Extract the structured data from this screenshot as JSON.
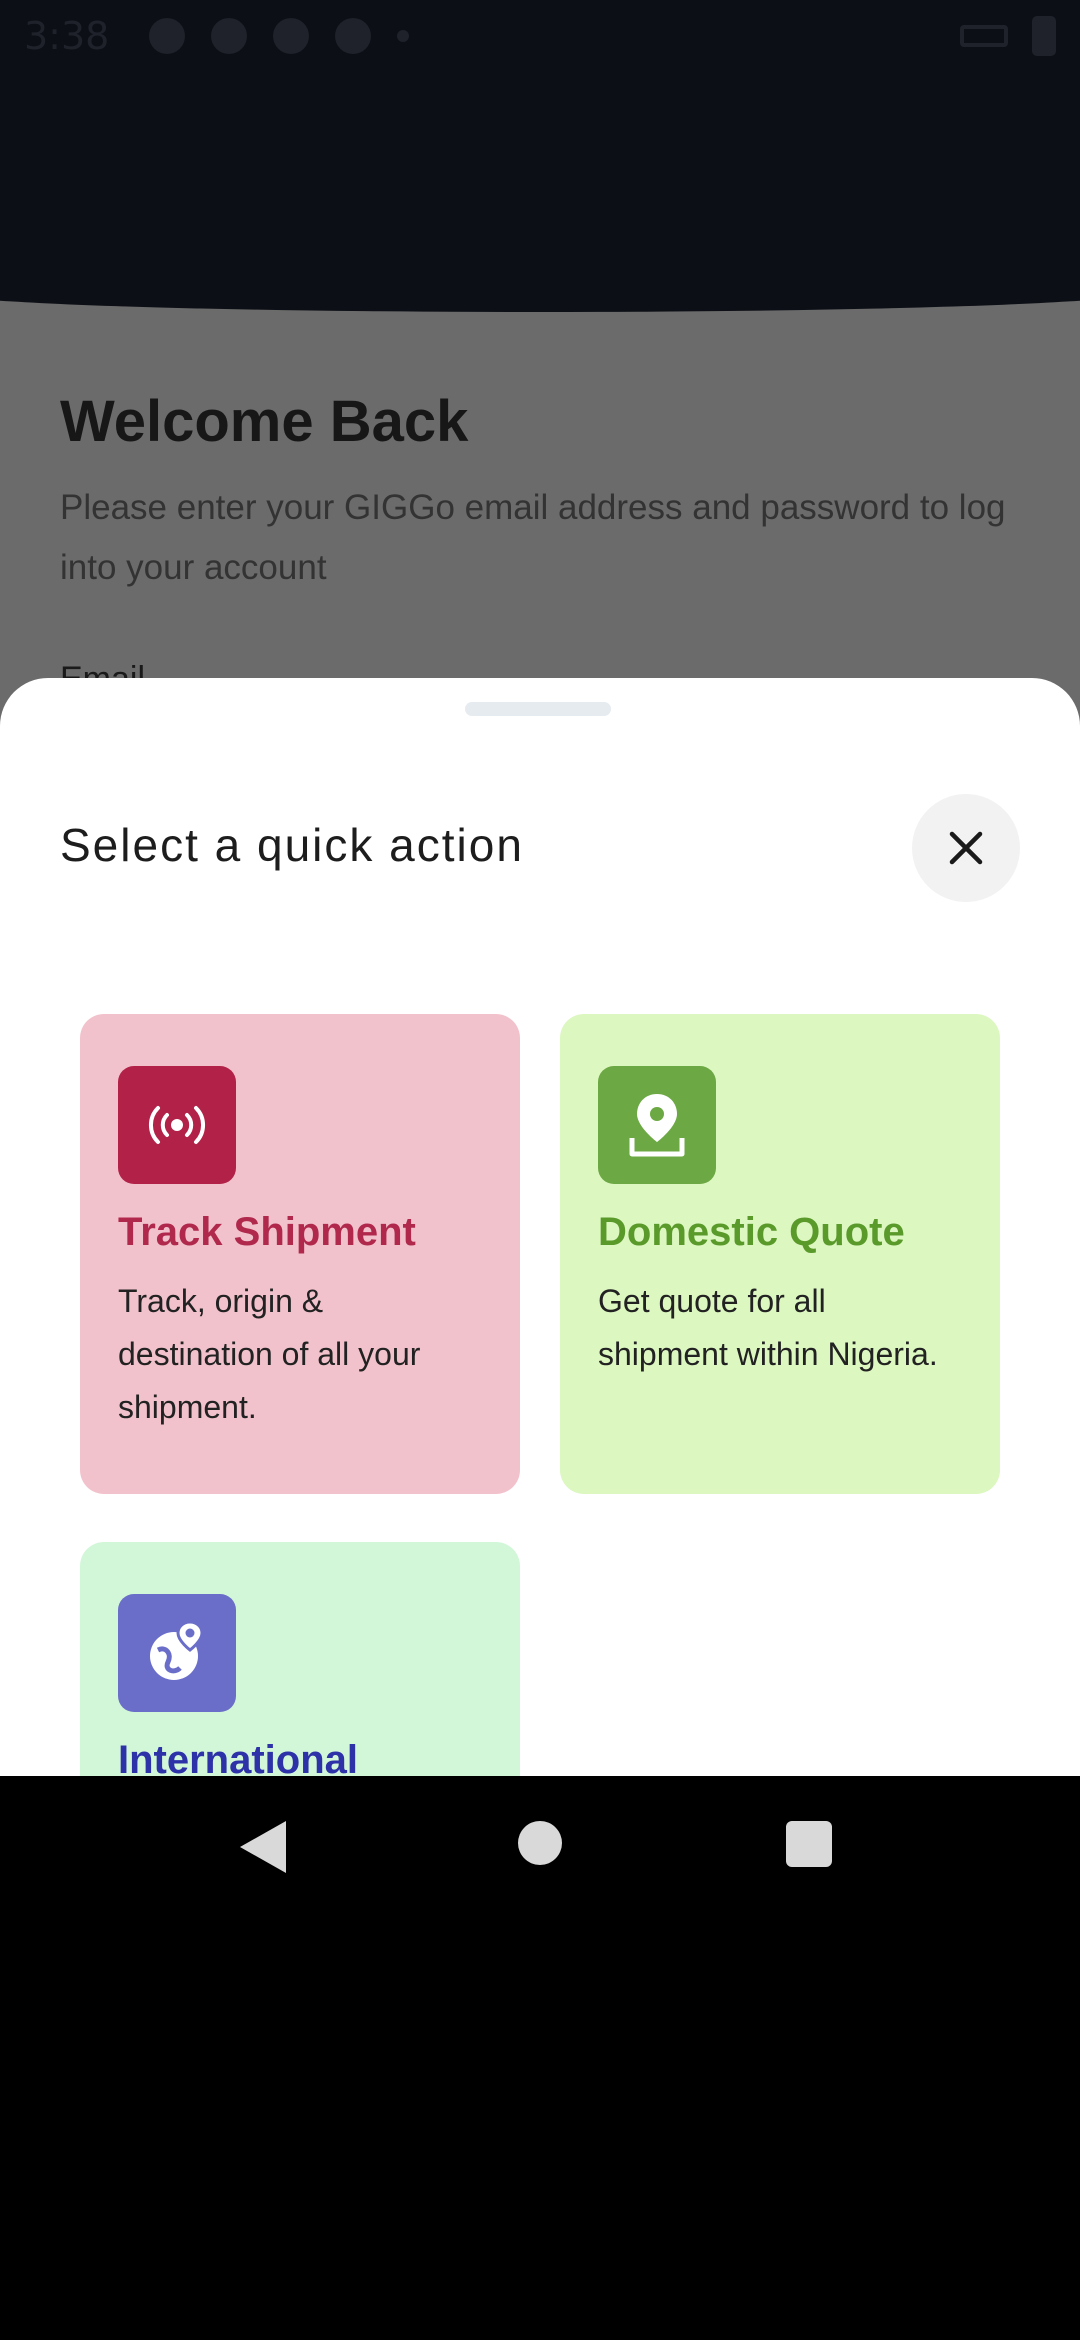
{
  "status_bar": {
    "time": "3:38"
  },
  "background": {
    "title": "Welcome Back",
    "subtitle": "Please enter your GIGGo email address and password to log into your account",
    "email_label": "Email"
  },
  "sheet": {
    "title": "Select a quick action",
    "close_icon": "close-icon",
    "cards": [
      {
        "icon": "signal-broadcast-icon",
        "title": "Track Shipment",
        "description": "Track, origin & destination of all your shipment.",
        "bg_color": "#f2c2cc",
        "icon_color": "#b22248",
        "title_color": "#b0294d"
      },
      {
        "icon": "location-pin-icon",
        "title": "Domestic Quote",
        "description": "Get quote for all shipment within Nigeria.",
        "bg_color": "#dcf7c0",
        "icon_color": "#6ca843",
        "title_color": "#5a9a2b"
      },
      {
        "icon": "globe-pin-icon",
        "title": "International",
        "description": "",
        "bg_color": "#d2f7d8",
        "icon_color": "#6a6ec9",
        "title_color": "#2d32a8"
      }
    ]
  },
  "nav_bar": {
    "back_icon": "back-triangle-icon",
    "home_icon": "home-circle-icon",
    "recents_icon": "recents-square-icon"
  }
}
